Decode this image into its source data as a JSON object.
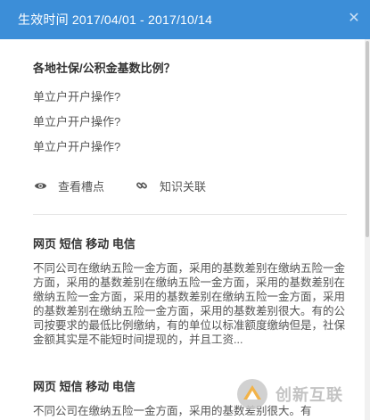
{
  "header": {
    "title": "生效时间 2017/04/01 - 2017/10/14",
    "close_icon": "close-icon"
  },
  "qa": {
    "question": "各地社保/公积金基数比例？",
    "items": [
      "单立户开户操作?",
      "单立户开户操作?",
      "单立户开户操作?"
    ]
  },
  "actions": [
    {
      "label": "查看槽点",
      "icon": "eye-icon"
    },
    {
      "label": "知识关联",
      "icon": "link-icon"
    }
  ],
  "sections": [
    {
      "title": "网页 短信 移动 电信",
      "body": "不同公司在缴纳五险一金方面，采用的基数差别在缴纳五险一金方面，采用的基数差别在缴纳五险一金方面，采用的基数差别在缴纳五险一金方面，采用的基数差别在缴纳五险一金方面，采用的基数差别在缴纳五险一金方面，采用的基数差别很大。有的公司按要求的最低比例缴纳，有的单位以标准额度缴纳但是，社保金额其实是不能短时间提现的，并且工资..."
    },
    {
      "title": "网页 短信 移动 电信",
      "body": "不同公司在缴纳五险一金方面，采用的基数差别很大。有"
    }
  ],
  "watermark": {
    "text": "创新互联"
  },
  "colors": {
    "header_bg": "#3c8ed8",
    "text": "#333333",
    "muted": "#555555"
  }
}
